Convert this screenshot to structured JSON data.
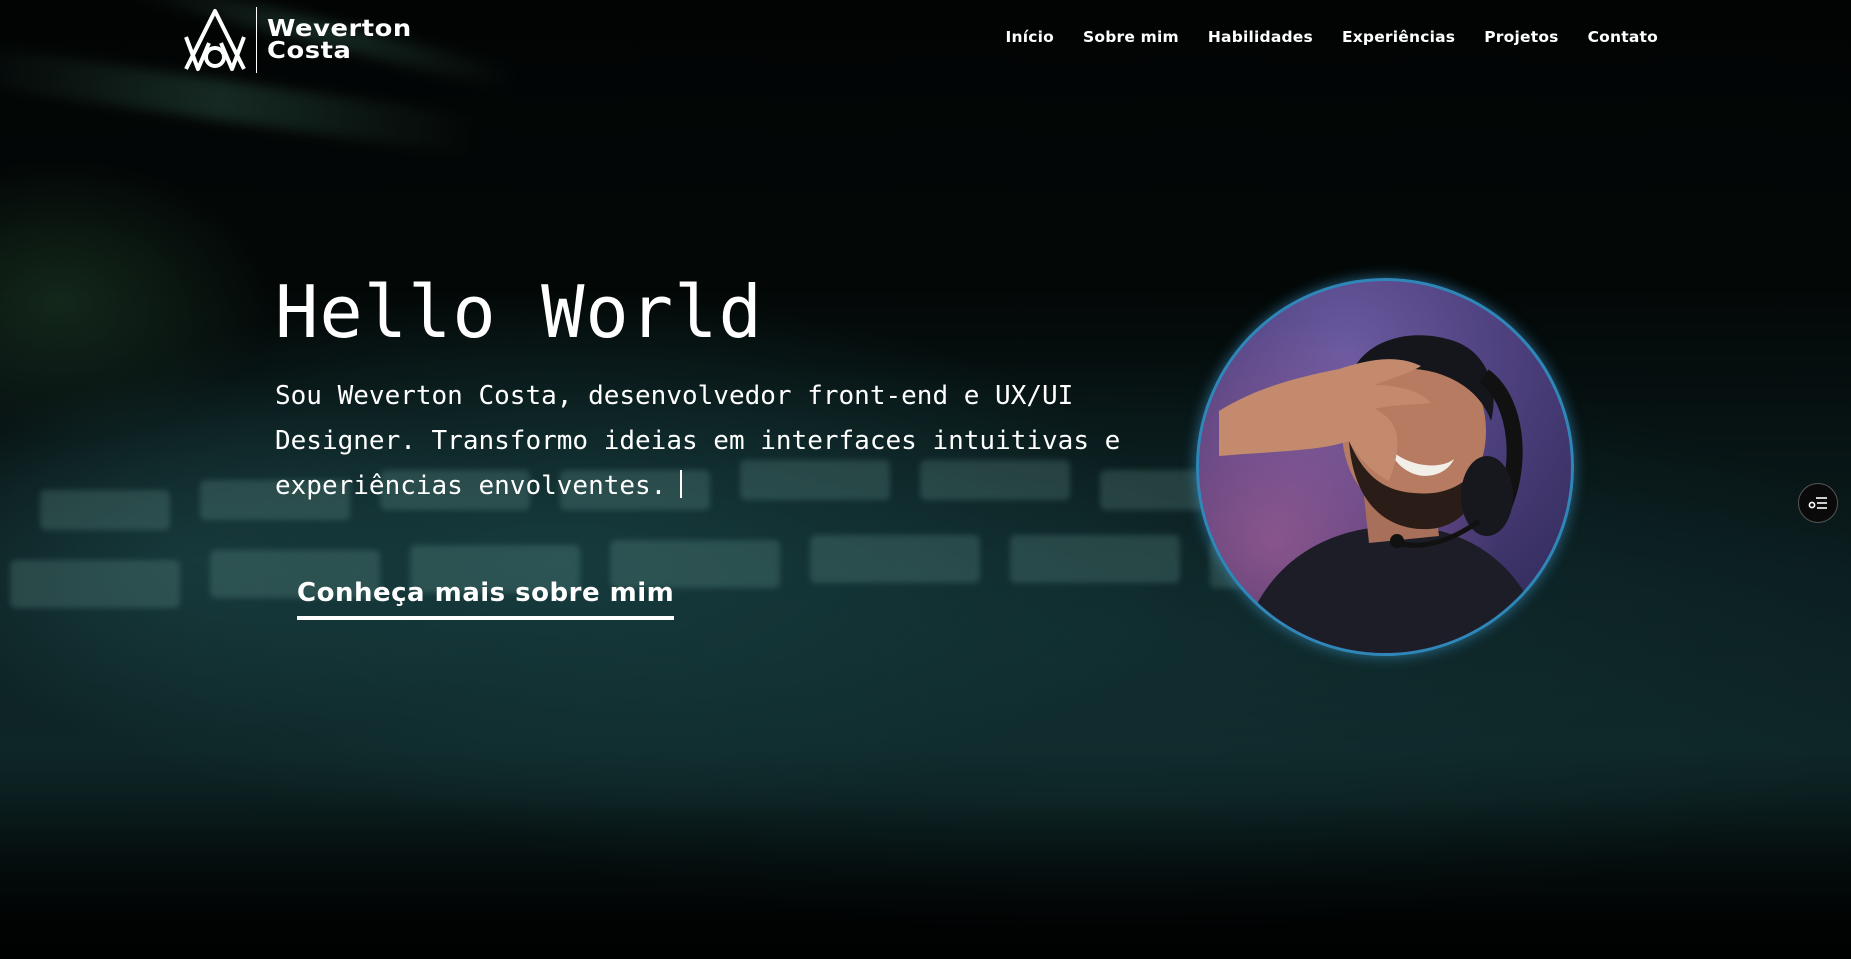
{
  "brand": {
    "line1": "Weverton",
    "line2": "Costa",
    "logo_icon": "wc-monogram-icon"
  },
  "nav": {
    "items": [
      {
        "label": "Início"
      },
      {
        "label": "Sobre mim"
      },
      {
        "label": "Habilidades"
      },
      {
        "label": "Experiências"
      },
      {
        "label": "Projetos"
      },
      {
        "label": "Contato"
      }
    ]
  },
  "hero": {
    "title": "Hello World",
    "description": "Sou Weverton Costa, desenvolvedor front-end e UX/UI\nDesigner. Transformo ideias em interfaces intuitivas e\nexperiências envolventes.",
    "cta_label": "Conheça mais sobre mim",
    "avatar_icon": "profile-photo"
  },
  "floating_button": {
    "icon": "settings-list-icon"
  },
  "colors": {
    "background": "#000000",
    "text": "#ffffff",
    "avatar_ring": "#2f86b8",
    "avatar_bg": "#4c3f7c"
  }
}
